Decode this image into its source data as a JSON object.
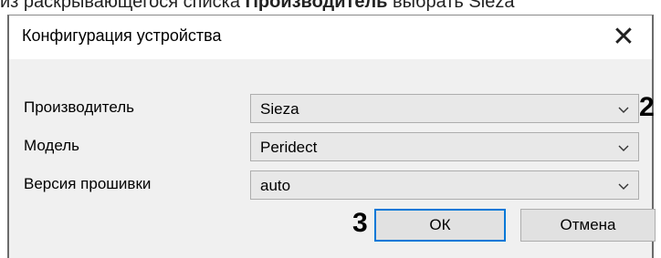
{
  "top_text": {
    "pre": "из раскрывающегося списка ",
    "bold": "Производитель",
    "post": " выбрать Sieza"
  },
  "dialog": {
    "title": "Конфигурация устройства",
    "close_glyph": "✕"
  },
  "fields": [
    {
      "label": "Производитель",
      "value": "Sieza"
    },
    {
      "label": "Модель",
      "value": "Peridect"
    },
    {
      "label": "Версия прошивки",
      "value": "auto"
    }
  ],
  "annotations": {
    "step_2": "2",
    "step_3": "3"
  },
  "buttons": {
    "ok": "ОК",
    "cancel": "Отмена"
  },
  "colors": {
    "default_button_border": "#0078d7",
    "dialog_bg": "#f0f0f0",
    "select_bg": "#e8e8e8"
  },
  "icons": {
    "dropdown": "chevron-down-icon",
    "close": "close-icon"
  }
}
